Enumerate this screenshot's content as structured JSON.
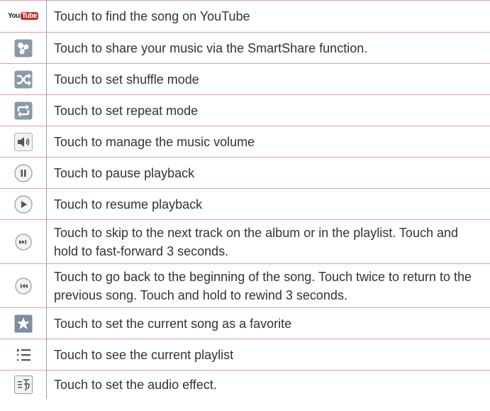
{
  "rows": [
    {
      "icon": "youtube-icon",
      "logo_you": "You",
      "logo_tube": "Tube",
      "text": "Touch to find the song on YouTube"
    },
    {
      "icon": "smartshare-icon",
      "text": "Touch to share your music via the SmartShare function."
    },
    {
      "icon": "shuffle-icon",
      "text": "Touch to set shuffle mode"
    },
    {
      "icon": "repeat-icon",
      "text": "Touch to set repeat mode"
    },
    {
      "icon": "volume-icon",
      "text": "Touch to manage the music volume"
    },
    {
      "icon": "pause-icon",
      "text": "Touch to pause playback"
    },
    {
      "icon": "play-icon",
      "text": "Touch to resume playback"
    },
    {
      "icon": "next-track-icon",
      "text": "Touch to skip to the next track on the album or in the playlist. Touch and hold to fast-forward 3 seconds."
    },
    {
      "icon": "previous-track-icon",
      "text": "Touch to go back to the beginning of the song. Touch twice to return to the previous song. Touch and hold to rewind 3 seconds."
    },
    {
      "icon": "favorite-star-icon",
      "text": "Touch to set the current song as a favorite"
    },
    {
      "icon": "playlist-icon",
      "text": "Touch to see the current playlist"
    },
    {
      "icon": "audio-effect-icon",
      "text": "Touch to set the audio effect."
    }
  ],
  "colors": {
    "row_divider": "#e89aa8",
    "column_divider": "#9a9a9a",
    "text": "#333333",
    "youtube_red": "#c4302b"
  }
}
